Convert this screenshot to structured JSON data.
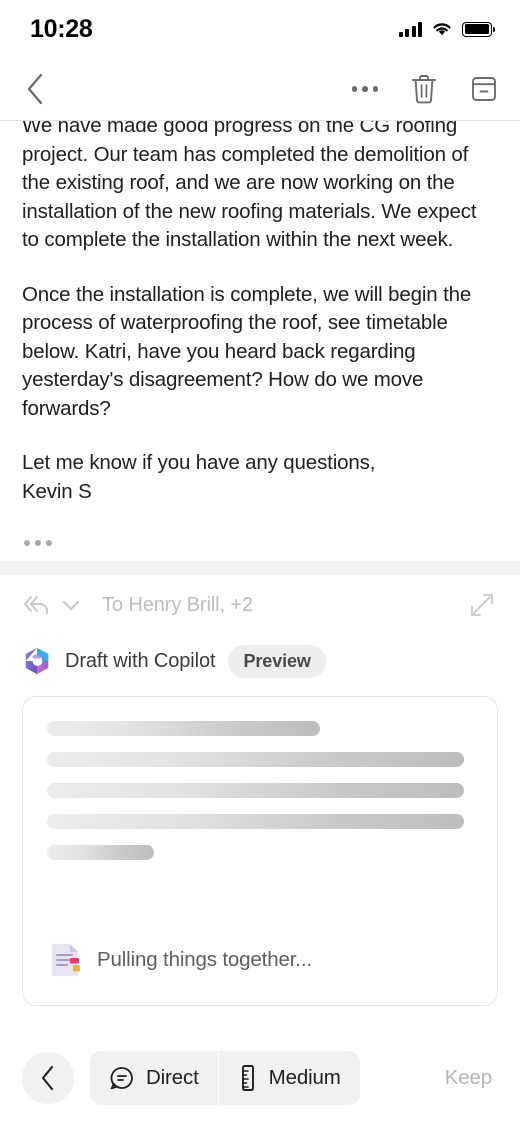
{
  "status_bar": {
    "time": "10:28",
    "icons": [
      "cellular-signal-icon",
      "wifi-icon",
      "battery-icon"
    ]
  },
  "nav_bar": {
    "back_label": "back-chevron-icon",
    "more_label": "more-options-icon",
    "delete_label": "trash-icon",
    "archive_label": "archive-icon"
  },
  "email": {
    "paragraphs": [
      "We have made good progress on the CG roofing project. Our team has completed the demolition of the existing roof, and we are now working on the installation of the new roofing materials. We expect to complete the installation within the next week.",
      "Once the installation is complete, we will begin the process of waterproofing the roof, see timetable below. Katri, have you heard back regarding yesterday's disagreement? How do we move forwards?",
      "Let me know if you have any questions,\nKevin S"
    ],
    "show_quoted_label": "show-quoted-text"
  },
  "reply": {
    "reply_all_icon": "reply-all-icon",
    "chevron_icon": "chevron-down-icon",
    "recipients": "To Henry Brill, +2",
    "expand_icon": "expand-icon"
  },
  "copilot": {
    "logo": "copilot-logo",
    "title": "Draft with Copilot",
    "badge": "Preview"
  },
  "draft_card": {
    "skeleton_widths": [
      "64%",
      "98%",
      "98%",
      "98%",
      "25%"
    ],
    "loading_icon": "document-icon",
    "loading_text": "Pulling things together..."
  },
  "toolbar": {
    "back_label": "back-chevron-icon",
    "tone": {
      "icon": "speech-bubble-icon",
      "label": "Direct"
    },
    "length": {
      "icon": "ruler-icon",
      "label": "Medium"
    },
    "keep_label": "Keep"
  },
  "colors": {
    "text_primary": "#1f1f1f",
    "text_muted": "#bdbdbd",
    "separator": "#e9e9e9",
    "pill_bg": "#eeeeee",
    "copilot_blue": "#2aa5e0",
    "copilot_purple": "#7b57c8",
    "copilot_magenta": "#c95bb5"
  }
}
